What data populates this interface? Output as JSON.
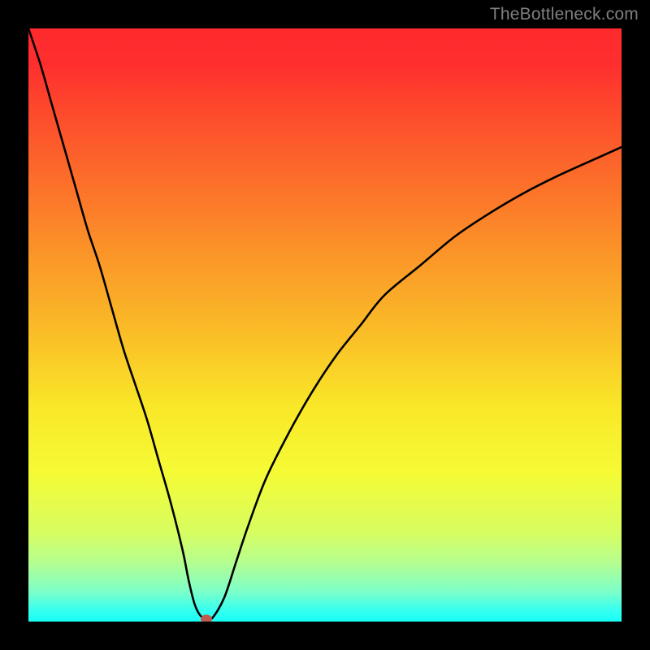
{
  "watermark": "TheBottleneck.com",
  "chart_data": {
    "type": "line",
    "title": "",
    "xlabel": "",
    "ylabel": "",
    "xlim": [
      0,
      100
    ],
    "ylim": [
      0,
      100
    ],
    "x_minimum": 30,
    "marker": {
      "x": 30,
      "y": 0
    },
    "series": [
      {
        "name": "curve",
        "x": [
          0,
          2,
          4,
          6,
          8,
          10,
          12,
          14,
          16,
          18,
          20,
          22,
          24,
          26,
          27,
          28,
          29,
          30,
          31,
          33,
          35,
          37,
          40,
          44,
          48,
          52,
          56,
          60,
          66,
          72,
          78,
          84,
          90,
          96,
          100
        ],
        "values": [
          100,
          94,
          87,
          80,
          73,
          66,
          60,
          53,
          46,
          40,
          34,
          27,
          20,
          12,
          7,
          3,
          1,
          0.6,
          0.6,
          4,
          10,
          16,
          24,
          32,
          39,
          45,
          50,
          55,
          60,
          65,
          69,
          72.5,
          75.5,
          78.2,
          80
        ]
      }
    ],
    "gradient_stops": [
      {
        "pos": 0,
        "color": "#fe2a2d"
      },
      {
        "pos": 50,
        "color": "#fabf27"
      },
      {
        "pos": 75,
        "color": "#f5fb35"
      },
      {
        "pos": 100,
        "color": "#17fff7"
      }
    ]
  }
}
